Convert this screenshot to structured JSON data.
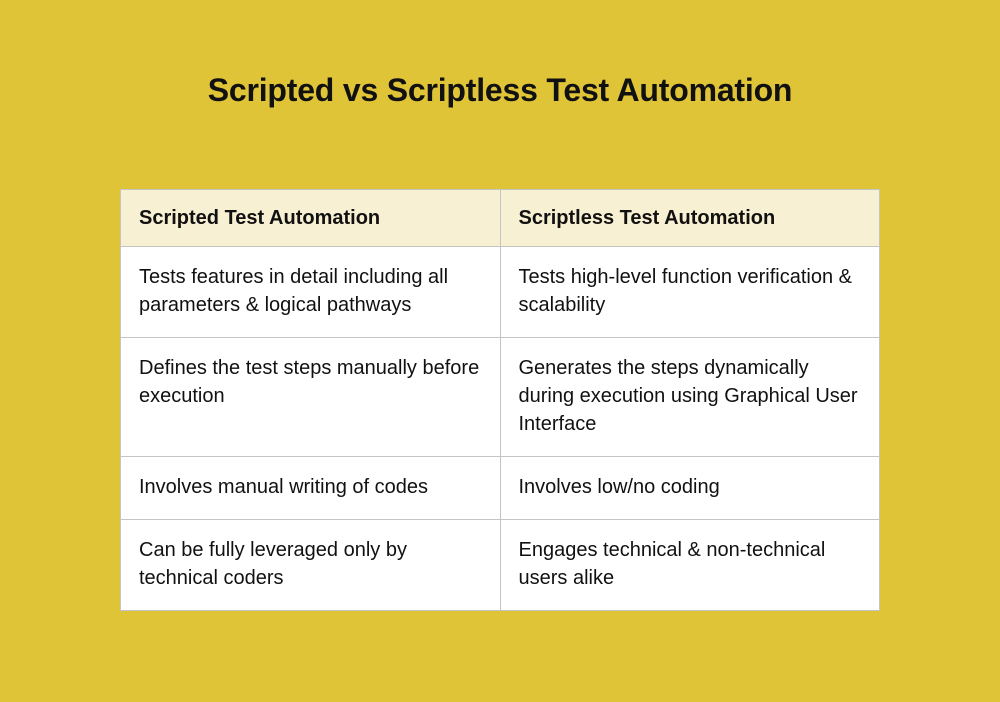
{
  "title": "Scripted vs Scriptless Test Automation",
  "chart_data": {
    "type": "table",
    "columns": [
      "Scripted Test Automation",
      "Scriptless Test Automation"
    ],
    "rows": [
      [
        "Tests features in detail including all parameters & logical pathways",
        "Tests high-level function verification & scalability"
      ],
      [
        "Defines the test steps manually before execution",
        "Generates the steps dynamically during execution using Graphical User Interface"
      ],
      [
        "Involves manual writing of codes",
        "Involves low/no coding"
      ],
      [
        "Can be fully leveraged only by technical coders",
        "Engages technical & non-technical users alike"
      ]
    ]
  }
}
